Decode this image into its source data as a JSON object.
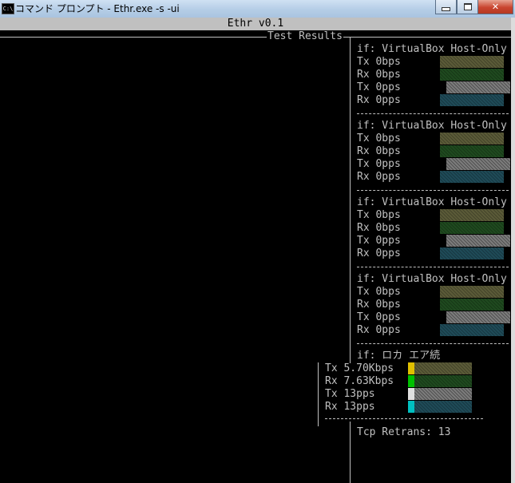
{
  "window": {
    "app_icon_label": "C:\\",
    "title": "コマンド プロンプト - Ethr.exe  -s -ui",
    "minimize_icon": "minimize-icon",
    "maximize_icon": "maximize-icon",
    "close_icon": "close-icon",
    "close_label": "✕"
  },
  "header": {
    "title": "Ethr v0.1"
  },
  "results": {
    "title": "Test Results"
  },
  "colors": {
    "titlebar": "#b5cde6",
    "console_bg": "#000000",
    "console_text": "#c0c0c0",
    "tx_bps": "#e0c000",
    "rx_bps": "#00c000",
    "tx_pps": "#e0e0e0",
    "rx_pps": "#00c0c0"
  },
  "interfaces": [
    {
      "name": "if: VirtualBox Host-Only",
      "metrics": [
        {
          "label": "Tx 0bps",
          "level": 0
        },
        {
          "label": "Rx 0bps",
          "level": 0
        },
        {
          "label": "Tx 0pps",
          "level": 0
        },
        {
          "label": "Rx 0pps",
          "level": 0
        }
      ]
    },
    {
      "name": "if: VirtualBox Host-Only",
      "metrics": [
        {
          "label": "Tx 0bps",
          "level": 0
        },
        {
          "label": "Rx 0bps",
          "level": 0
        },
        {
          "label": "Tx 0pps",
          "level": 0
        },
        {
          "label": "Rx 0pps",
          "level": 0
        }
      ]
    },
    {
      "name": "if: VirtualBox Host-Only",
      "metrics": [
        {
          "label": "Tx 0bps",
          "level": 0
        },
        {
          "label": "Rx 0bps",
          "level": 0
        },
        {
          "label": "Tx 0pps",
          "level": 0
        },
        {
          "label": "Rx 0pps",
          "level": 0
        }
      ]
    },
    {
      "name": "if: VirtualBox Host-Only",
      "metrics": [
        {
          "label": "Tx 0bps",
          "level": 0
        },
        {
          "label": "Rx 0bps",
          "level": 0
        },
        {
          "label": "Tx 0pps",
          "level": 0
        },
        {
          "label": "Rx 0pps",
          "level": 0
        }
      ]
    },
    {
      "name": "if: ロカ エア続",
      "metrics": [
        {
          "label": "Tx 5.70Kbps",
          "level": 0.1
        },
        {
          "label": "Rx 7.63Kbps",
          "level": 0.1
        },
        {
          "label": "Tx 13pps",
          "level": 0.1
        },
        {
          "label": "Rx 13pps",
          "level": 0.1
        }
      ]
    }
  ],
  "tcp_retrans": "Tcp Retrans: 13"
}
